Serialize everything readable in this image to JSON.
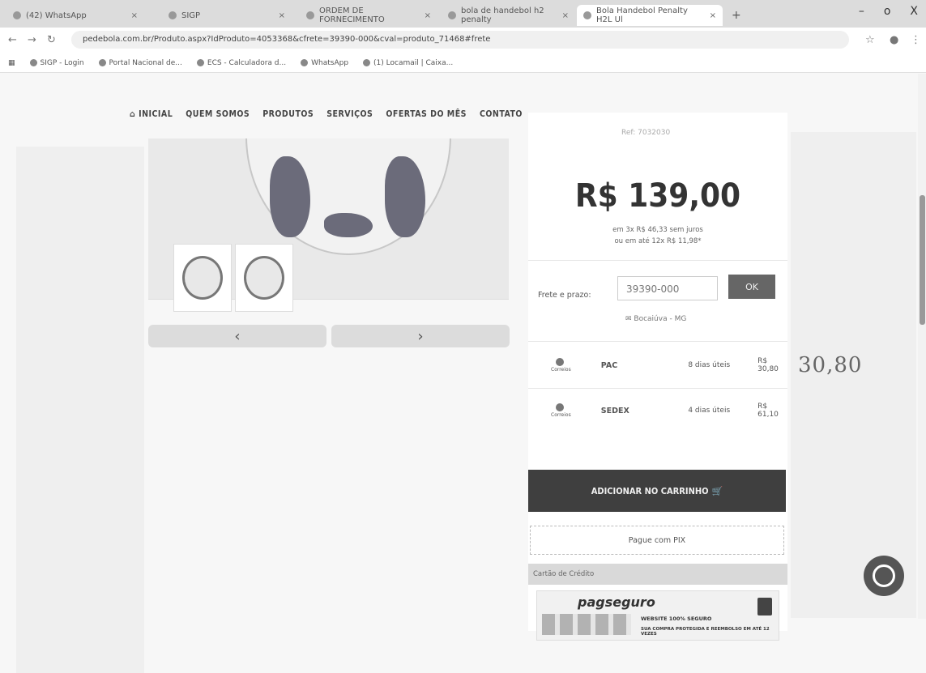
{
  "browser": {
    "tabs": [
      {
        "label": "(42) WhatsApp",
        "active": false
      },
      {
        "label": "SIGP",
        "active": false
      },
      {
        "label": "ORDEM DE FORNECIMENTO",
        "active": false
      },
      {
        "label": "bola de handebol h2 penalty",
        "active": false
      },
      {
        "label": "Bola Handebol Penalty H2L Ul",
        "active": true
      }
    ],
    "new_tab": "+",
    "url": "pedebola.com.br/Produto.aspx?IdProduto=4053368&cfrete=39390-000&cval=produto_71468#frete",
    "bookmarks": [
      "SIGP - Login",
      "Portal Nacional de...",
      "ECS - Calculadora d...",
      "WhatsApp",
      "(1) Locamail | Caixa..."
    ],
    "window_controls": {
      "minimize": "–",
      "maximize": "o",
      "close": "X"
    }
  },
  "nav": {
    "items": [
      "INICIAL",
      "QUEM SOMOS",
      "PRODUTOS",
      "SERVIÇOS",
      "OFERTAS DO MÊS",
      "CONTATO"
    ]
  },
  "product": {
    "ref": "Ref: 7032030",
    "price": "R$ 139,00",
    "installments_line1": "em 3x R$ 46,33 sem juros",
    "installments_line2": "ou em até 12x R$ 11,98*",
    "carousel_prev": "‹",
    "carousel_next": "›"
  },
  "shipping": {
    "label": "Frete e prazo:",
    "cep": "39390-000",
    "ok": "OK",
    "city": "Bocaiúva - MG",
    "options": [
      {
        "carrier": "Correios",
        "service": "PAC",
        "days": "8 dias úteis",
        "price": "R$ 30,80"
      },
      {
        "carrier": "Correios",
        "service": "SEDEX",
        "days": "4 dias úteis",
        "price": "R$ 61,10"
      }
    ]
  },
  "actions": {
    "add_to_cart": "ADICIONAR NO CARRINHO",
    "pix": "Pague com PIX",
    "credit_card_header": "Cartão de Crédito"
  },
  "pagseguro": {
    "brand": "pagseguro",
    "secure": "WEBSITE 100% SEGURO",
    "secure_sub": "SUA COMPRA PROTEGIDA E REEMBOLSO EM ATÉ 12 VEZES"
  },
  "handwritten_note": "30,80",
  "colors": {
    "cart_button": "#3f3f3f",
    "ok_button": "#666666"
  }
}
